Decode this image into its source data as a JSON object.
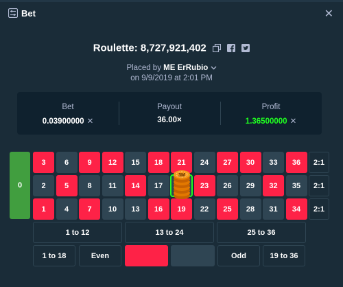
{
  "modal": {
    "title": "Bet",
    "close_icon": "close-icon"
  },
  "game": {
    "name": "Roulette: 8,727,921,402"
  },
  "placed": {
    "prefix": "Placed by",
    "user": "ME ErRubio",
    "date": "on 9/9/2019 at 2:01 PM"
  },
  "stats": {
    "bet_label": "Bet",
    "bet_value": "0.03900000",
    "bet_x": "✕",
    "payout_label": "Payout",
    "payout_value": "36.00×",
    "profit_label": "Profit",
    "profit_value": "1.36500000",
    "profit_x": "✕"
  },
  "table": {
    "zero": "0",
    "top_row": [
      "3",
      "6",
      "9",
      "12",
      "15",
      "18",
      "21",
      "24",
      "27",
      "30",
      "33",
      "36"
    ],
    "mid_row": [
      "2",
      "5",
      "8",
      "11",
      "14",
      "17",
      "20",
      "23",
      "26",
      "29",
      "32",
      "35"
    ],
    "bot_row": [
      "1",
      "4",
      "7",
      "10",
      "13",
      "16",
      "19",
      "22",
      "25",
      "28",
      "31",
      "34"
    ],
    "columns": [
      "2:1",
      "2:1",
      "2:1"
    ],
    "dozens": [
      "1 to 12",
      "13 to 24",
      "25 to 36"
    ],
    "outside": {
      "low": "1 to 18",
      "even": "Even",
      "odd": "Odd",
      "high": "19 to 36"
    },
    "chip_label": "3M",
    "selected_number": "20"
  },
  "colors": {
    "red": "#fe2247",
    "dark": "#2f4553",
    "green": "#419e3f",
    "profit": "#1fff20"
  }
}
